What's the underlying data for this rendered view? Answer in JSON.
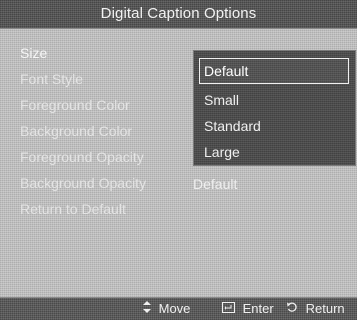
{
  "title": "Digital Caption Options",
  "menu": {
    "items": [
      {
        "label": "Size"
      },
      {
        "label": "Font Style"
      },
      {
        "label": "Foreground Color"
      },
      {
        "label": "Background Color"
      },
      {
        "label": "Foreground Opacity"
      },
      {
        "label": "Background Opacity"
      },
      {
        "label": "Return to Default"
      }
    ],
    "background_opacity_value": "Default"
  },
  "dropdown": {
    "options": [
      {
        "label": "Default"
      },
      {
        "label": "Small"
      },
      {
        "label": "Standard"
      },
      {
        "label": "Large"
      }
    ],
    "selected": "Default"
  },
  "footer": {
    "move": "Move",
    "enter": "Enter",
    "return": "Return"
  },
  "icons": {
    "move": "updown-arrow-icon",
    "enter": "enter-icon",
    "return": "return-icon"
  },
  "colors": {
    "background": "#bdbdbd",
    "title_bar": "#555555",
    "dropdown": "#4b4b4b",
    "text": "#efefef"
  }
}
